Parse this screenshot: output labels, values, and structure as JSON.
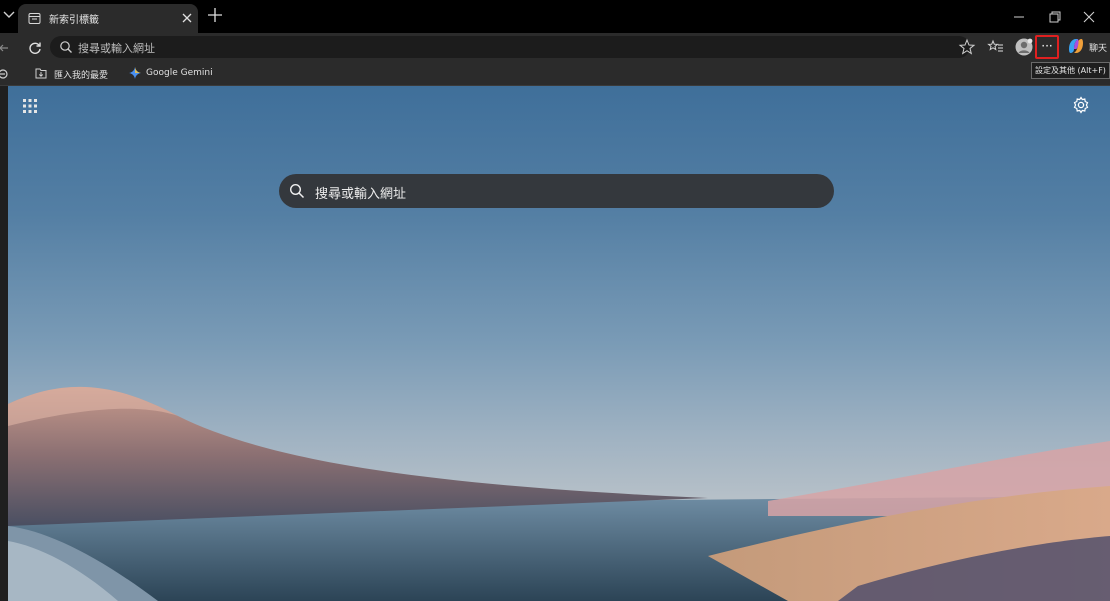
{
  "tab": {
    "title": "新索引標籤"
  },
  "toolbar": {
    "address_placeholder": "搜尋或輸入網址",
    "more_tooltip": "設定及其他 (Alt+F)",
    "copilot_label": "聊天"
  },
  "favorites": {
    "items": [
      {
        "label": "匯入我的最愛",
        "icon": "import-favorites-icon"
      },
      {
        "label": "Google Gemini",
        "icon": "gemini-icon"
      }
    ]
  },
  "new_tab_page": {
    "search_placeholder": "搜尋或輸入網址"
  },
  "colors": {
    "more_button_highlight": "#e02020",
    "tab_strip": "#000000",
    "toolbar": "#2b2b2b"
  }
}
